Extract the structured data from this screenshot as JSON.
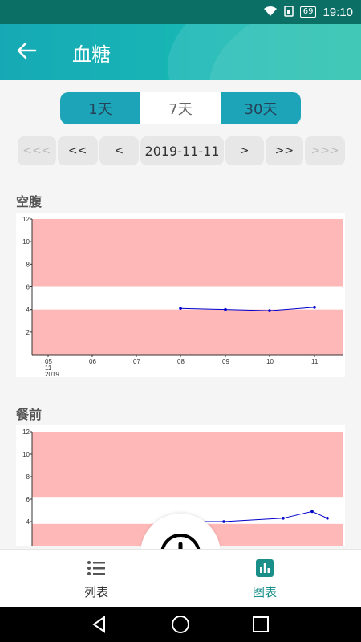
{
  "status": {
    "time": "19:10",
    "battery": "69"
  },
  "header": {
    "title": "血糖"
  },
  "range_tabs": [
    "1天",
    "7天",
    "30天"
  ],
  "date_nav": {
    "first": "<<<",
    "prev_big": "<<",
    "prev": "<",
    "date": "2019-11-11",
    "next": ">",
    "next_big": ">>",
    "last": ">>>"
  },
  "sections": [
    {
      "title": "空腹"
    },
    {
      "title": "餐前"
    }
  ],
  "chart_data": [
    {
      "type": "line",
      "title": "空腹",
      "ylim": [
        0,
        12
      ],
      "yticks": [
        "12",
        "10",
        "8",
        "6",
        "4",
        "2"
      ],
      "xlabels": [
        "05",
        "06",
        "07",
        "08",
        "09",
        "10",
        "11"
      ],
      "xsub": [
        "11",
        "2019"
      ],
      "bands": [
        {
          "from": 0,
          "to": 4
        },
        {
          "from": 6,
          "to": 12
        }
      ],
      "series": [
        {
          "x": [
            "08",
            "09",
            "10",
            "11"
          ],
          "y": [
            4.1,
            4.0,
            3.9,
            4.2
          ]
        }
      ],
      "color": "#0000cc",
      "band_color": "#ffb8b8"
    },
    {
      "type": "line",
      "title": "餐前",
      "ylim": [
        0,
        12
      ],
      "yticks": [
        "12",
        "10",
        "8",
        "6",
        "4"
      ],
      "bands": [
        {
          "from": 0,
          "to": 3.8
        },
        {
          "from": 6.2,
          "to": 12
        }
      ],
      "series": [
        {
          "y": [
            4.0,
            4.0,
            4.3,
            4.9,
            4.3
          ]
        }
      ],
      "color": "#0000cc",
      "band_color": "#ffb8b8"
    }
  ],
  "tabs": {
    "list": "列表",
    "chart": "图表"
  }
}
